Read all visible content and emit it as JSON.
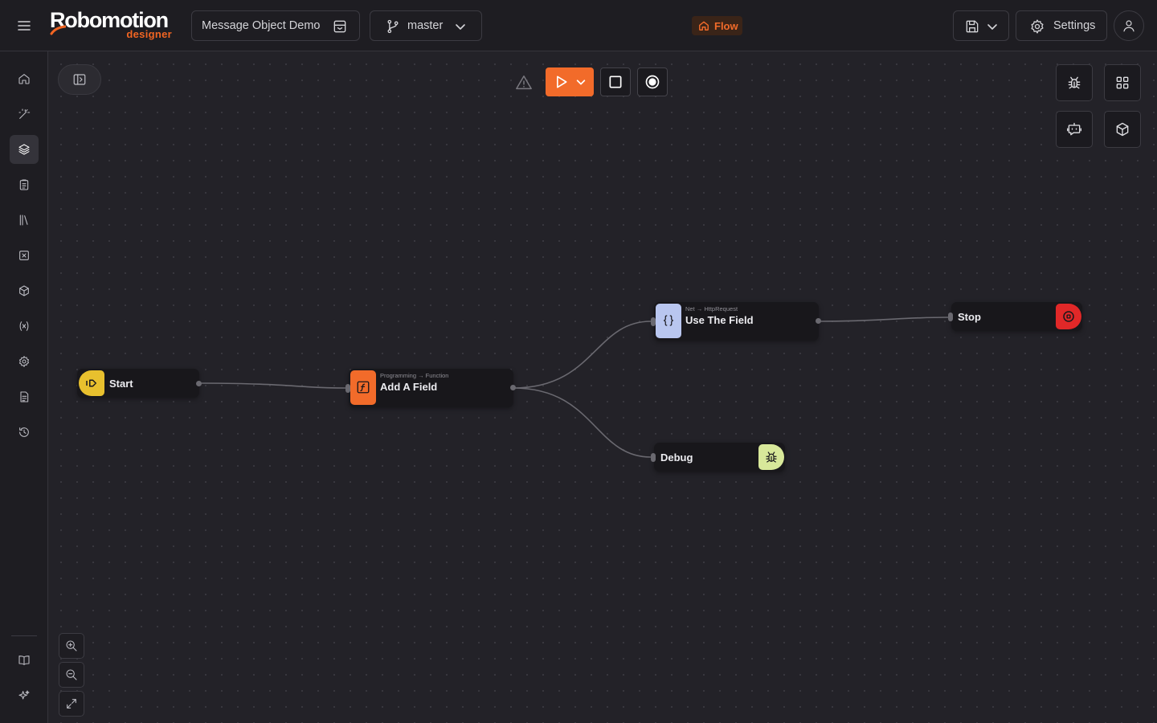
{
  "app": {
    "logo_text": "Robomotion",
    "logo_sub": "designer",
    "project_name": "Message Object Demo",
    "branch": "master",
    "flow_badge": "Flow",
    "settings_label": "Settings"
  },
  "sidebar": {
    "items": [
      {
        "icon": "home-icon"
      },
      {
        "icon": "magic-wand-icon"
      },
      {
        "icon": "layers-icon",
        "active": true
      },
      {
        "icon": "clipboard-icon"
      },
      {
        "icon": "library-icon"
      },
      {
        "icon": "variable-box-icon"
      },
      {
        "icon": "package-icon"
      },
      {
        "icon": "variable-icon"
      },
      {
        "icon": "gear-icon"
      },
      {
        "icon": "document-icon"
      },
      {
        "icon": "history-icon"
      }
    ],
    "bottom_items": [
      {
        "icon": "book-icon"
      },
      {
        "icon": "sparkles-icon"
      }
    ]
  },
  "nodes": {
    "start": {
      "label": "Start",
      "color": "#e8c02e"
    },
    "add_field": {
      "category": "Programming → Function",
      "label": "Add A Field",
      "color": "#f26b2a"
    },
    "use_field": {
      "category": "Net → HttpRequest",
      "label": "Use The Field",
      "color": "#b9c6ef"
    },
    "stop": {
      "label": "Stop",
      "color": "#e12828"
    },
    "debug": {
      "label": "Debug",
      "color": "#d8e89a"
    }
  },
  "colors": {
    "accent": "#f26b2a",
    "background": "#232228",
    "panel": "#1e1d22"
  }
}
